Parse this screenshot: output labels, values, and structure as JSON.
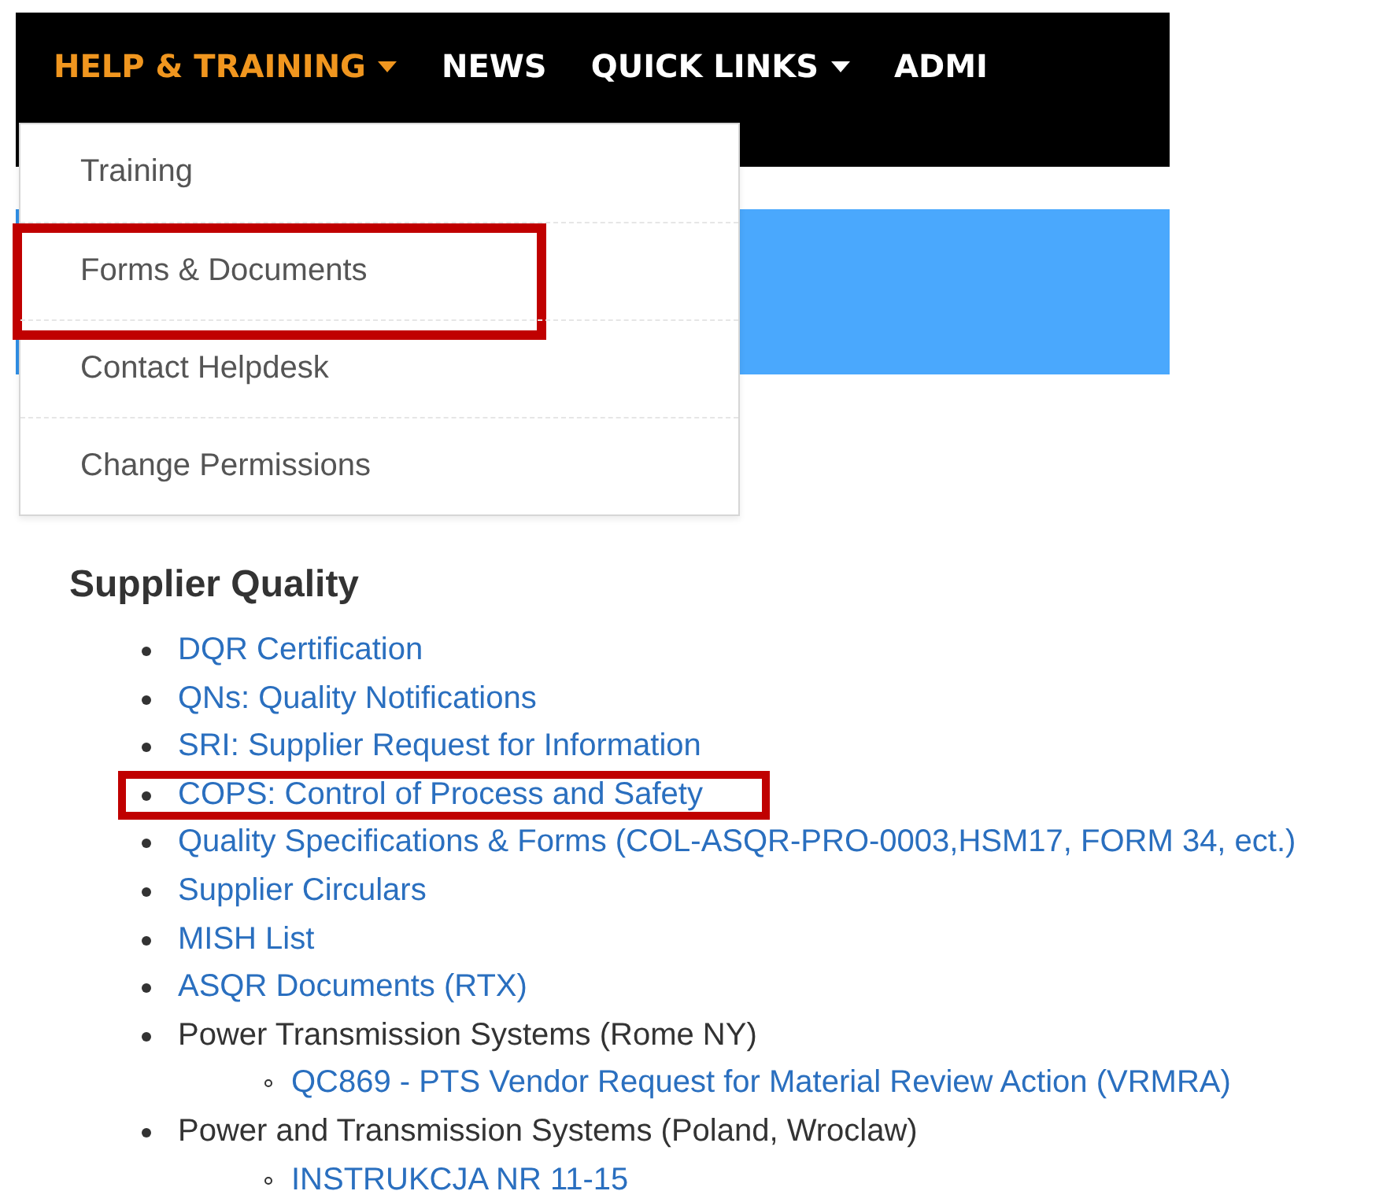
{
  "nav": [
    {
      "label": "HELP & TRAINING",
      "caret": true,
      "selected": true
    },
    {
      "label": "NEWS",
      "caret": false,
      "selected": false
    },
    {
      "label": "QUICK LINKS",
      "caret": true,
      "selected": false
    },
    {
      "label": "ADMI",
      "caret": false,
      "selected": false
    }
  ],
  "dropdown": [
    {
      "label": "Training",
      "highlighted": false
    },
    {
      "label": "Forms & Documents",
      "highlighted": true
    },
    {
      "label": "Contact Helpdesk",
      "highlighted": false
    },
    {
      "label": "Change Permissions",
      "highlighted": false
    }
  ],
  "section": {
    "title": "Supplier Quality",
    "items": [
      {
        "label": "DQR Certification",
        "kind": "link",
        "highlighted": false
      },
      {
        "label": "QNs: Quality Notifications",
        "kind": "link",
        "highlighted": false
      },
      {
        "label": "SRI: Supplier Request for Information",
        "kind": "link",
        "highlighted": false
      },
      {
        "label": "COPS: Control of Process and Safety",
        "kind": "link",
        "highlighted": true
      },
      {
        "label": "Quality Specifications & Forms (COL-ASQR-PRO-0003,HSM17, FORM 34, ect.)",
        "kind": "link",
        "highlighted": false
      },
      {
        "label": "Supplier Circulars",
        "kind": "link",
        "highlighted": false
      },
      {
        "label": "MISH List",
        "kind": "link",
        "highlighted": false
      },
      {
        "label": "ASQR Documents (RTX)",
        "kind": "link",
        "highlighted": false
      },
      {
        "label": "Power Transmission Systems (Rome NY)",
        "kind": "text",
        "highlighted": false,
        "children": [
          {
            "label": "QC869 - PTS Vendor Request for Material Review Action (VRMRA)",
            "kind": "link",
            "highlighted": false
          }
        ]
      },
      {
        "label": "Power and Transmission Systems (Poland, Wroclaw)",
        "kind": "text",
        "highlighted": false,
        "children": [
          {
            "label": "INSTRUKCJA NR 11-15",
            "kind": "link",
            "highlighted": false
          }
        ]
      }
    ]
  }
}
